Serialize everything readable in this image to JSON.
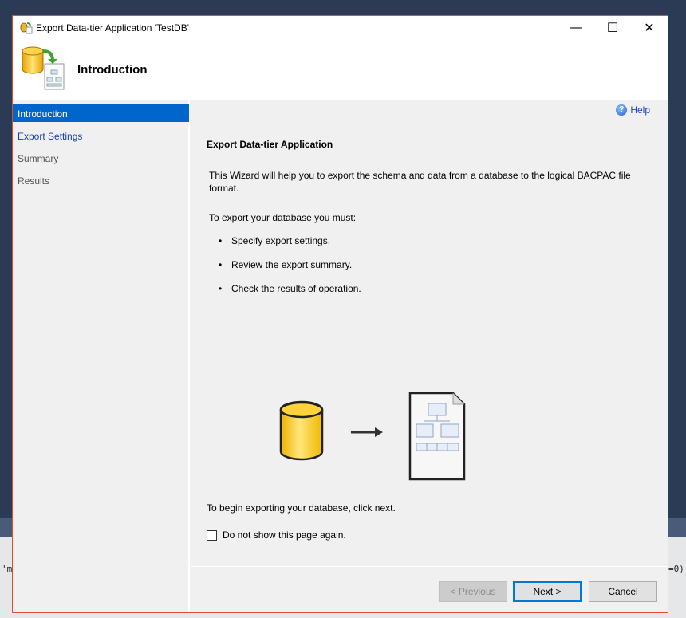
{
  "background": {
    "left_fragment": "'mo",
    "right_fragment": "=0)"
  },
  "window": {
    "title": "Export Data-tier Application 'TestDB'",
    "controls": {
      "minimize": "—",
      "maximize": "☐",
      "close": "✕"
    }
  },
  "header": {
    "title": "Introduction"
  },
  "sidebar": {
    "items": [
      {
        "label": "Introduction",
        "state": "selected"
      },
      {
        "label": "Export Settings",
        "state": "link"
      },
      {
        "label": "Summary",
        "state": "disabled"
      },
      {
        "label": "Results",
        "state": "disabled"
      }
    ]
  },
  "content": {
    "help": "Help",
    "heading": "Export Data-tier Application",
    "intro_line1": "This Wizard will help you to export the schema and data from a database to the logical BACPAC file",
    "intro_line2": "format.",
    "must": "To export your database you must:",
    "bullets": [
      "Specify export settings.",
      "Review the export summary.",
      "Check the results of operation."
    ],
    "begin": "To begin exporting your database, click next.",
    "checkbox_label": "Do not show this page again.",
    "checkbox_checked": false
  },
  "buttons": {
    "previous": "< Previous",
    "next": "Next >",
    "cancel": "Cancel"
  },
  "colors": {
    "accent": "#0066cc",
    "window_border": "#d9532c",
    "link": "#1a3fa8"
  }
}
